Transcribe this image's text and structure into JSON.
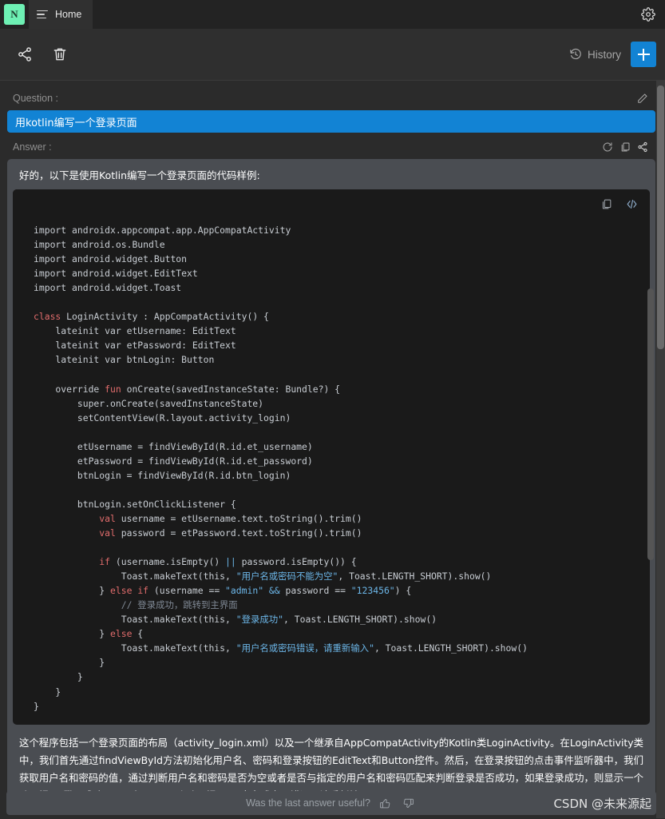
{
  "titlebar": {
    "logo_letter": "N",
    "tab_label": "Home",
    "menu_icon": "hamburger-icon",
    "settings_icon": "gear-icon"
  },
  "toolbar": {
    "share_icon": "share-icon",
    "delete_icon": "trash-icon",
    "history_label": "History",
    "history_icon": "clock-rewind-icon",
    "new_button_icon": "plus-icon"
  },
  "question": {
    "label": "Question :",
    "edit_icon": "pencil-icon",
    "text": "用kotlin编写一个登录页面"
  },
  "answer": {
    "label": "Answer :",
    "actions": [
      "refresh-icon",
      "copy-icon",
      "share-icon"
    ],
    "intro": "好的，以下是使用Kotlin编写一个登录页面的代码样例:",
    "code_actions": [
      "copy-icon",
      "code-brackets-icon"
    ],
    "code_language": "kotlin",
    "code": "import androidx.appcompat.app.AppCompatActivity\nimport android.os.Bundle\nimport android.widget.Button\nimport android.widget.EditText\nimport android.widget.Toast\n\nclass LoginActivity : AppCompatActivity() {\n    lateinit var etUsername: EditText\n    lateinit var etPassword: EditText\n    lateinit var btnLogin: Button\n\n    override fun onCreate(savedInstanceState: Bundle?) {\n        super.onCreate(savedInstanceState)\n        setContentView(R.layout.activity_login)\n\n        etUsername = findViewById(R.id.et_username)\n        etPassword = findViewById(R.id.et_password)\n        btnLogin = findViewById(R.id.btn_login)\n\n        btnLogin.setOnClickListener {\n            val username = etUsername.text.toString().trim()\n            val password = etPassword.text.toString().trim()\n\n            if (username.isEmpty() || password.isEmpty()) {\n                Toast.makeText(this, \"用户名或密码不能为空\", Toast.LENGTH_SHORT).show()\n            } else if (username == \"admin\" && password == \"123456\") {\n                // 登录成功，跳转到主界面\n                Toast.makeText(this, \"登录成功\", Toast.LENGTH_SHORT).show()\n            } else {\n                Toast.makeText(this, \"用户名或密码错误，请重新输入\", Toast.LENGTH_SHORT).show()\n            }\n        }\n    }\n}",
    "explanation": "这个程序包括一个登录页面的布局（activity_login.xml）以及一个继承自AppCompatActivity的Kotlin类LoginActivity。在LoginActivity类中，我们首先通过findViewById方法初始化用户名、密码和登录按钮的EditText和Button控件。然后，在登录按钮的点击事件监听器中，我们获取用户名和密码的值，通过判断用户名和密码是否为空或者是否与指定的用户名和密码匹配来判断登录是否成功，如果登录成功，则显示一个吐司提示\"登录成功\"。否则，显示一个吐司提示\"用户名或密码错误，请重新输入\"。"
  },
  "footer": {
    "prompt": "Was the last answer useful?",
    "thumbs_up_icon": "thumbs-up-icon",
    "thumbs_down_icon": "thumbs-down-icon",
    "watermark": "CSDN @未来源起"
  },
  "colors": {
    "accent_blue": "#1283d4",
    "logo_green": "#6ef0b4",
    "answer_bg": "#4a4d52",
    "code_bg": "#1a1a1a",
    "window_bg": "#2b2b2b"
  }
}
